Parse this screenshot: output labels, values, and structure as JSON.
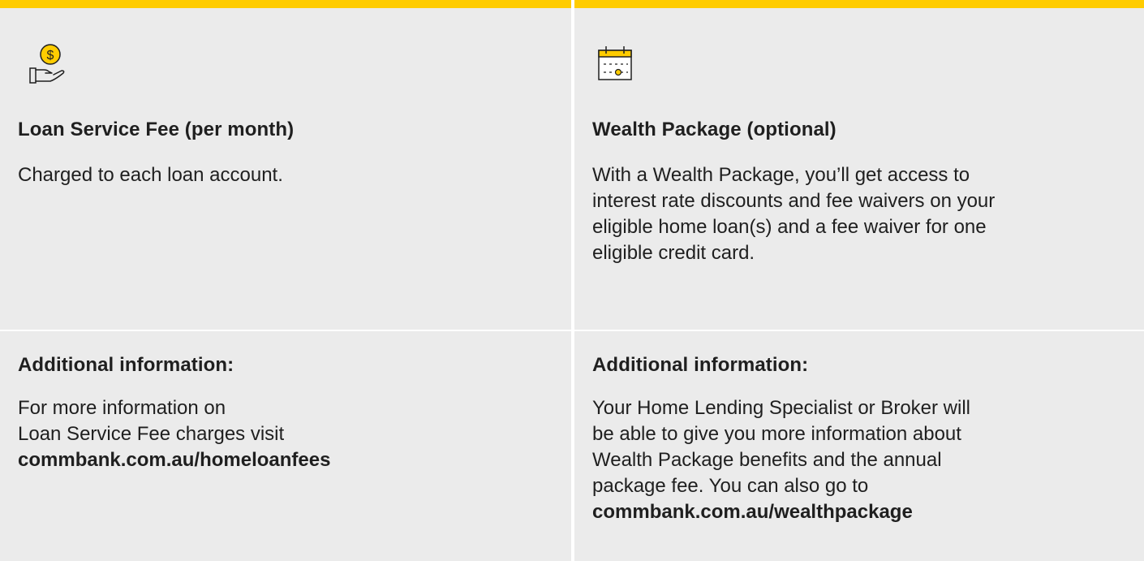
{
  "colors": {
    "accent": "#ffcc00",
    "panel": "#ebebeb",
    "text": "#1f1f1f"
  },
  "loan_fee": {
    "icon": "hand-coin-icon",
    "title": "Loan Service Fee (per month)",
    "description": "Charged to each loan account."
  },
  "wealth_package": {
    "icon": "calendar-icon",
    "title": "Wealth Package (optional)",
    "description_lines": [
      "With a Wealth Package, you’ll get access to",
      "interest rate discounts and fee waivers on your",
      "eligible home loan(s) and a fee waiver for one",
      "eligible credit card."
    ]
  },
  "loan_fee_info": {
    "title": "Additional information:",
    "lines": [
      "For more information on",
      "Loan Service Fee charges visit"
    ],
    "link": "commbank.com.au/homeloanfees"
  },
  "wealth_package_info": {
    "title": "Additional information:",
    "lines": [
      "Your Home Lending Specialist or Broker will",
      "be able to give you more information about",
      "Wealth Package benefits and the annual",
      "package fee. You can also go to"
    ],
    "link": "commbank.com.au/wealthpackage"
  }
}
